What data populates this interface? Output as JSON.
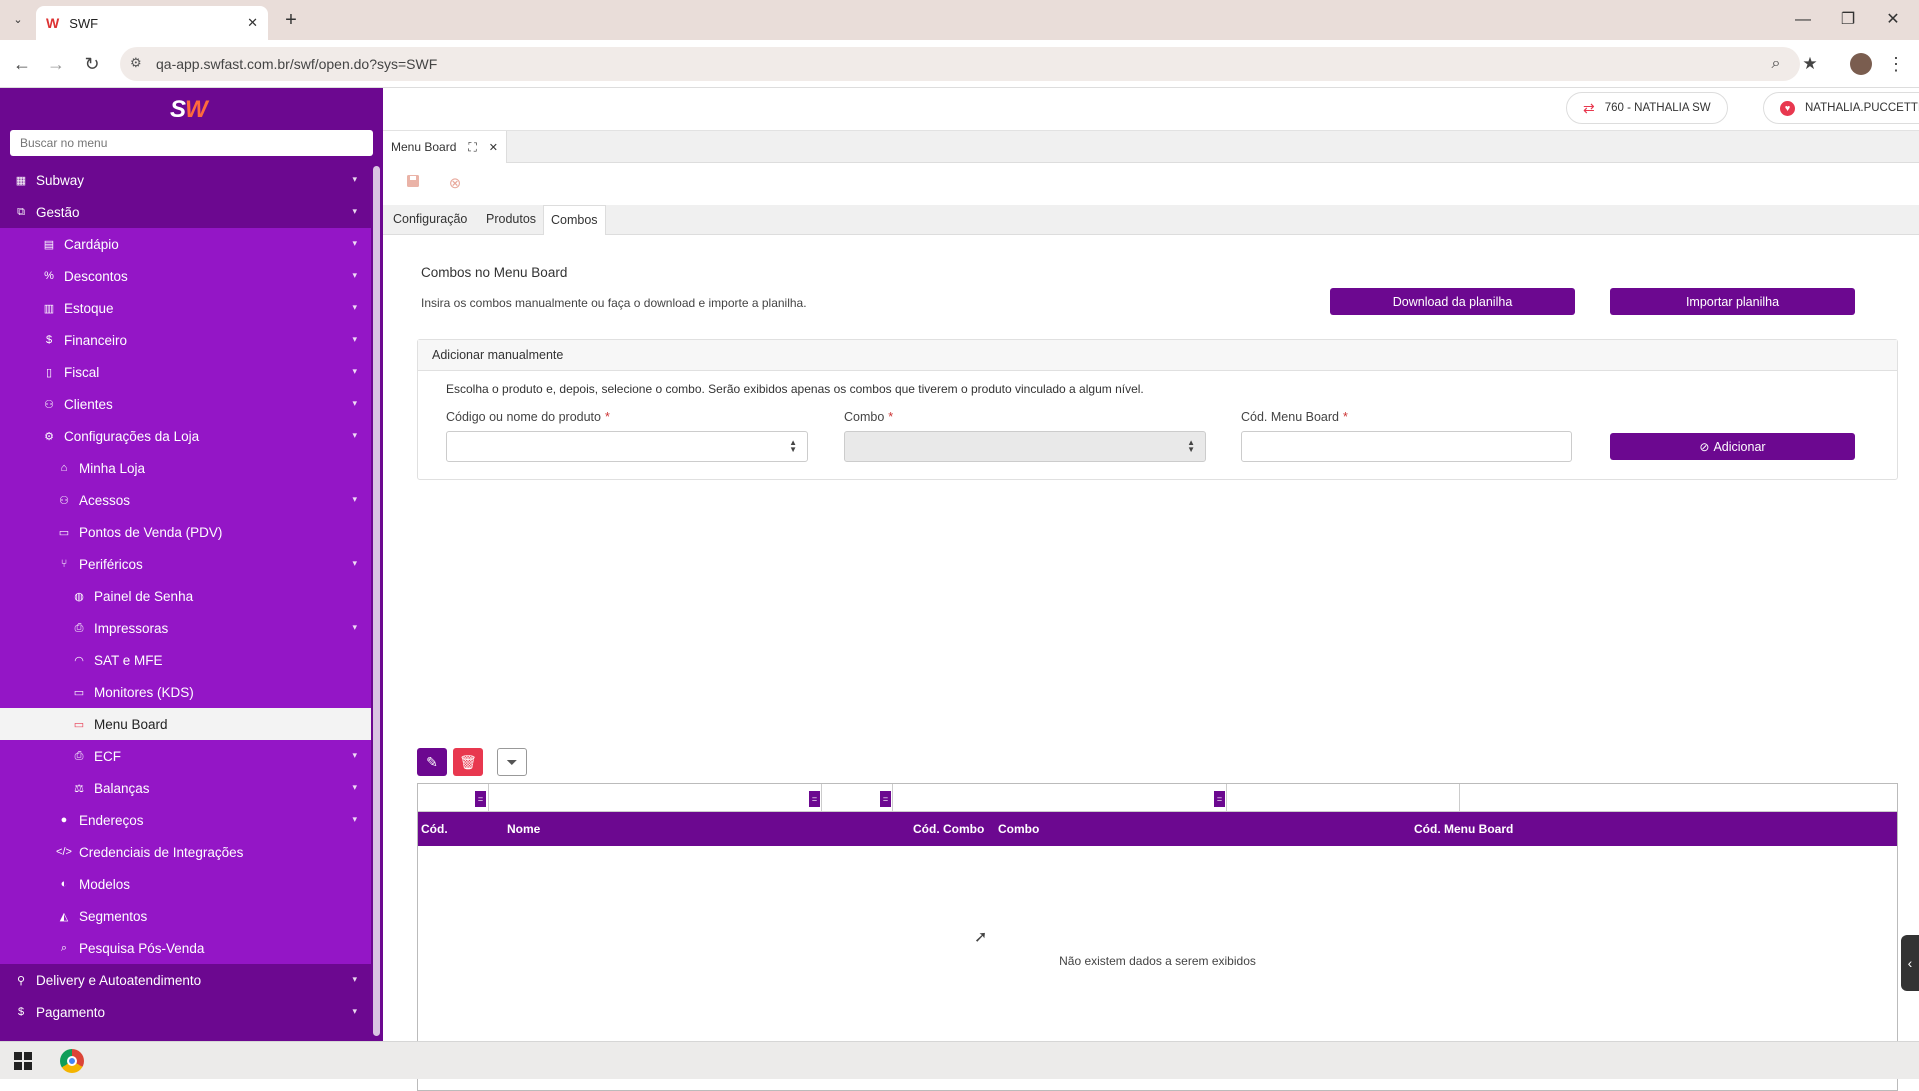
{
  "browser": {
    "tab_title": "SWF",
    "url": "qa-app.swfast.com.br/swf/open.do?sys=SWF"
  },
  "sidebar": {
    "logo_text": "SW",
    "search_placeholder": "Buscar no menu",
    "items": [
      {
        "label": "Subway",
        "level": 0,
        "icon": "building-icon",
        "chevron": true
      },
      {
        "label": "Gestão",
        "level": 0,
        "icon": "sitemap-icon",
        "chevron": true
      },
      {
        "label": "Cardápio",
        "level": 1,
        "icon": "book-icon",
        "chevron": true
      },
      {
        "label": "Descontos",
        "level": 1,
        "icon": "percent-icon",
        "chevron": true
      },
      {
        "label": "Estoque",
        "level": 1,
        "icon": "boxes-icon",
        "chevron": true
      },
      {
        "label": "Financeiro",
        "level": 1,
        "icon": "dollar-icon",
        "chevron": true
      },
      {
        "label": "Fiscal",
        "level": 1,
        "icon": "file-icon",
        "chevron": true
      },
      {
        "label": "Clientes",
        "level": 1,
        "icon": "users-icon",
        "chevron": true
      },
      {
        "label": "Configurações da Loja",
        "level": 1,
        "icon": "cogs-icon",
        "chevron": true
      },
      {
        "label": "Minha Loja",
        "level": 2,
        "icon": "store-icon",
        "chevron": false
      },
      {
        "label": "Acessos",
        "level": 2,
        "icon": "users-icon",
        "chevron": true
      },
      {
        "label": "Pontos de Venda (PDV)",
        "level": 2,
        "icon": "laptop-icon",
        "chevron": false
      },
      {
        "label": "Periféricos",
        "level": 2,
        "icon": "branch-icon",
        "chevron": true
      },
      {
        "label": "Painel de Senha",
        "level": 3,
        "icon": "globe-icon",
        "chevron": false
      },
      {
        "label": "Impressoras",
        "level": 3,
        "icon": "printer-icon",
        "chevron": true
      },
      {
        "label": "SAT e MFE",
        "level": 3,
        "icon": "wifi-icon",
        "chevron": false
      },
      {
        "label": "Monitores (KDS)",
        "level": 3,
        "icon": "monitor-icon",
        "chevron": false
      },
      {
        "label": "Menu Board",
        "level": 3,
        "icon": "monitor-icon",
        "chevron": false,
        "active": true
      },
      {
        "label": "ECF",
        "level": 3,
        "icon": "printer-icon",
        "chevron": true
      },
      {
        "label": "Balanças",
        "level": 3,
        "icon": "scale-icon",
        "chevron": true
      },
      {
        "label": "Endereços",
        "level": 2,
        "icon": "map-pin-icon",
        "chevron": true
      },
      {
        "label": "Credenciais de Integrações",
        "level": 2,
        "icon": "code-icon",
        "chevron": false
      },
      {
        "label": "Modelos",
        "level": 2,
        "icon": "palette-icon",
        "chevron": false
      },
      {
        "label": "Segmentos",
        "level": 2,
        "icon": "shapes-icon",
        "chevron": false
      },
      {
        "label": "Pesquisa Pós-Venda",
        "level": 2,
        "icon": "search-icon",
        "chevron": false
      },
      {
        "label": "Delivery e Autoatendimento",
        "level": 0,
        "icon": "motorcycle-icon",
        "chevron": true
      },
      {
        "label": "Pagamento",
        "level": 0,
        "icon": "dollar-icon",
        "chevron": true
      }
    ]
  },
  "header": {
    "store_pill": "760 - NATHALIA SW",
    "user_pill": "NATHALIA.PUCCETTI"
  },
  "page_tab": {
    "label": "Menu Board"
  },
  "subtabs": [
    "Configuração",
    "Produtos",
    "Combos"
  ],
  "main": {
    "title": "Combos no Menu Board",
    "description": "Insira os combos manualmente ou faça o download e importe a planilha.",
    "download_button": "Download da planilha",
    "import_button": "Importar planilha",
    "manual": {
      "header": "Adicionar manualmente",
      "hint": "Escolha o produto e, depois, selecione o combo. Serão exibidos apenas os combos que tiverem o produto vinculado a algum nível.",
      "product_label": "Código ou nome do produto",
      "combo_label": "Combo",
      "menuboard_label": "Cód. Menu Board",
      "required_mark": "*",
      "add_button": "Adicionar"
    },
    "grid": {
      "columns": [
        "Cód.",
        "Nome",
        "Cód. Combo",
        "Combo",
        "Cód. Menu Board"
      ],
      "filter_marker": "=",
      "empty_message": "Não existem dados a serem exibidos"
    }
  },
  "colors": {
    "primary": "#6c0890",
    "sidebar_sub": "#9416c6",
    "danger": "#e8384f"
  }
}
